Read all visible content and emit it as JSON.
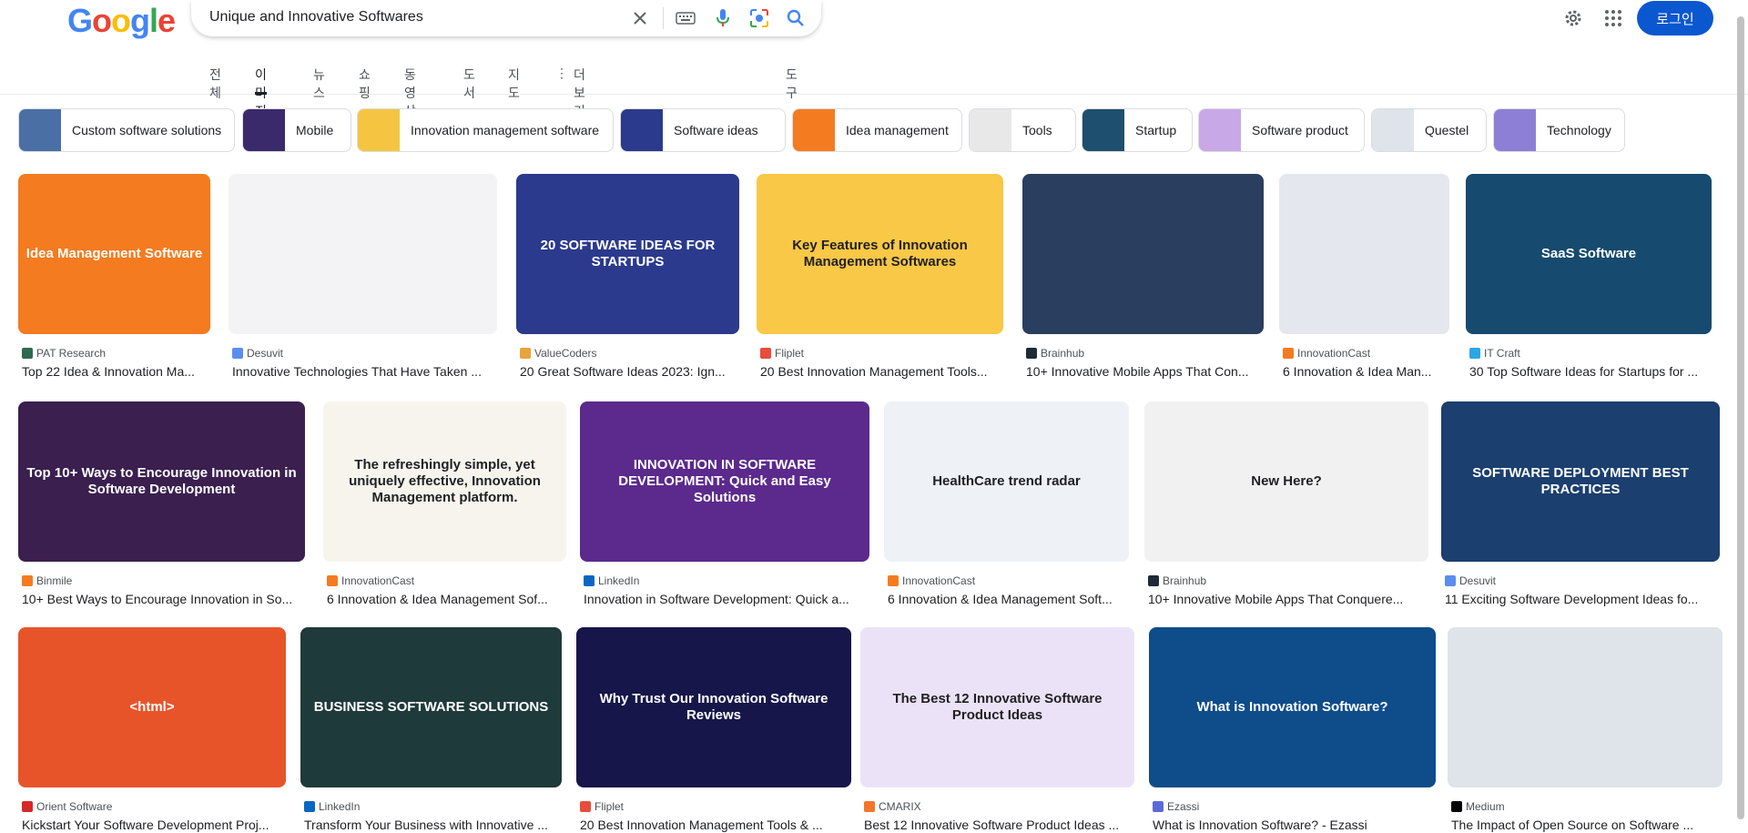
{
  "logo": [
    "G",
    "o",
    "o",
    "g",
    "l",
    "e"
  ],
  "search": {
    "query": "Unique and Innovative Softwares"
  },
  "header": {
    "login_label": "로그인"
  },
  "tabs": [
    {
      "label": "전체"
    },
    {
      "label": "이미지"
    },
    {
      "label": "뉴스"
    },
    {
      "label": "쇼핑"
    },
    {
      "label": "동영상"
    },
    {
      "label": "도서"
    },
    {
      "label": "지도"
    },
    {
      "label": "더보기"
    },
    {
      "label": "도구"
    }
  ],
  "chips": [
    {
      "label": "Custom software solutions",
      "color": "#4a6fa5"
    },
    {
      "label": "Mobile",
      "color": "#3b2a6b"
    },
    {
      "label": "Innovation management software",
      "color": "#f5c542"
    },
    {
      "label": "Software ideas",
      "color": "#2b3a8c"
    },
    {
      "label": "Idea management",
      "color": "#f47b20"
    },
    {
      "label": "Tools",
      "color": "#e8e8e8"
    },
    {
      "label": "Startup",
      "color": "#1e4f6e"
    },
    {
      "label": "Software product",
      "color": "#c9a8e8"
    },
    {
      "label": "Questel",
      "color": "#dfe3ea"
    },
    {
      "label": "Technology",
      "color": "#8e7fd6"
    }
  ],
  "results": [
    {
      "source": "PAT Research",
      "title": "Top 22 Idea & Innovation Ma...",
      "img_text": "Idea Management Software",
      "bg": "#f47b20",
      "fav": "#2d6a4f"
    },
    {
      "source": "Desuvit",
      "title": "Innovative Technologies That Have Taken ...",
      "img_text": "",
      "bg": "#f3f3f6",
      "fav": "#5b8def"
    },
    {
      "source": "ValueCoders",
      "title": "20 Great Software Ideas 2023: Ign...",
      "img_text": "20 SOFTWARE IDEAS FOR STARTUPS",
      "bg": "#2b3a8c",
      "fav": "#e8a33d"
    },
    {
      "source": "Fliplet",
      "title": "20 Best Innovation Management Tools...",
      "img_text": "Key Features of Innovation Management Softwares",
      "bg": "#f9c846",
      "fav": "#e84c3d"
    },
    {
      "source": "Brainhub",
      "title": "10+ Innovative Mobile Apps That Con...",
      "img_text": "",
      "bg": "#2a3f5f",
      "fav": "#1e2a38"
    },
    {
      "source": "InnovationCast",
      "title": "6 Innovation & Idea Man...",
      "img_text": "",
      "bg": "#e4e8ee",
      "fav": "#f47b20"
    },
    {
      "source": "IT Craft",
      "title": "30 Top Software Ideas for Startups for ...",
      "img_text": "SaaS Software",
      "bg": "#164a6e",
      "fav": "#2ca6e0"
    },
    {
      "source": "Binmile",
      "title": "10+ Best Ways to Encourage Innovation in So...",
      "img_text": "Top 10+ Ways to Encourage Innovation in Software Development",
      "bg": "#3a1f4f",
      "fav": "#f47b20"
    },
    {
      "source": "InnovationCast",
      "title": "6 Innovation & Idea Management Sof...",
      "img_text": "The refreshingly simple, yet uniquely effective, Innovation Management platform.",
      "bg": "#f7f4ee",
      "fav": "#f47b20"
    },
    {
      "source": "LinkedIn",
      "title": "Innovation in Software Development: Quick a...",
      "img_text": "INNOVATION IN SOFTWARE DEVELOPMENT: Quick and Easy Solutions",
      "bg": "#5b2a8c",
      "fav": "#0a66c2"
    },
    {
      "source": "InnovationCast",
      "title": "6 Innovation & Idea Management Soft...",
      "img_text": "HealthCare trend radar",
      "bg": "#eef1f6",
      "fav": "#f47b20"
    },
    {
      "source": "Brainhub",
      "title": "10+ Innovative Mobile Apps That Conquere...",
      "img_text": "New Here?",
      "bg": "#f1f1f1",
      "fav": "#1e2a38"
    },
    {
      "source": "Desuvit",
      "title": "11 Exciting Software Development Ideas fo...",
      "img_text": "SOFTWARE DEPLOYMENT BEST PRACTICES",
      "bg": "#1b3f6e",
      "fav": "#5b8def"
    },
    {
      "source": "Orient Software",
      "title": "Kickstart Your Software Development Proj...",
      "img_text": "<html>",
      "bg": "#e8542a",
      "fav": "#d62828"
    },
    {
      "source": "LinkedIn",
      "title": "Transform Your Business with Innovative ...",
      "img_text": "BUSINESS SOFTWARE SOLUTIONS",
      "bg": "#1f3a3a",
      "fav": "#0a66c2"
    },
    {
      "source": "Fliplet",
      "title": "20 Best Innovation Management Tools & ...",
      "img_text": "Why Trust Our Innovation Software Reviews",
      "bg": "#16164a",
      "fav": "#e84c3d"
    },
    {
      "source": "CMARIX",
      "title": "Best 12 Innovative Software Product Ideas ...",
      "img_text": "The Best 12 Innovative Software Product Ideas",
      "bg": "#ece2f7",
      "fav": "#f4762a"
    },
    {
      "source": "Ezassi",
      "title": "What is Innovation Software? - Ezassi",
      "img_text": "What is Innovation Software?",
      "bg": "#0f4c8a",
      "fav": "#5b6bd6"
    },
    {
      "source": "Medium",
      "title": "The Impact of Open Source on Software ...",
      "img_text": "",
      "bg": "#dfe3ea",
      "fav": "#000000"
    }
  ]
}
